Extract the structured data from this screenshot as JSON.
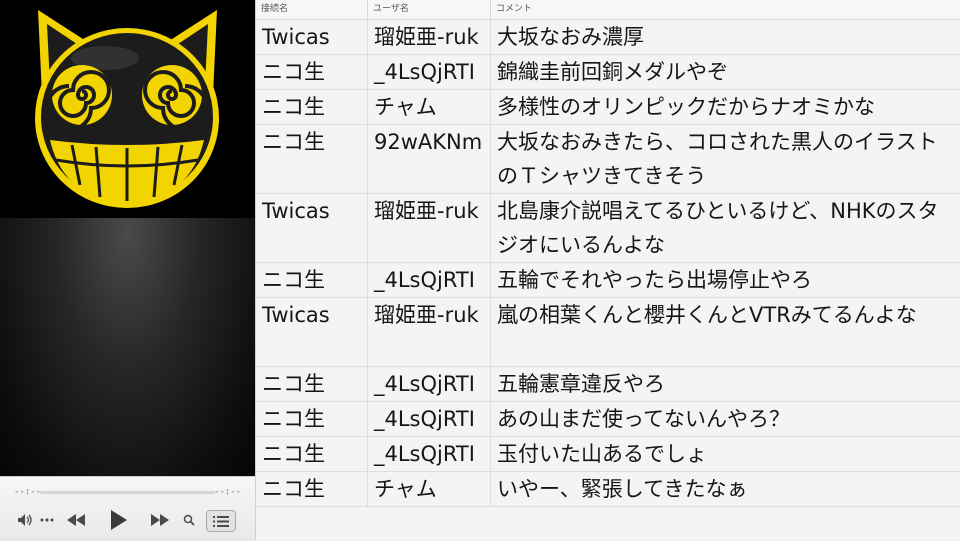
{
  "player": {
    "time_elapsed": "--:--",
    "time_remaining": "--:--",
    "controls": [
      "volume-icon",
      "more-icon",
      "rewind-icon",
      "play-icon",
      "fast-forward-icon",
      "search-icon",
      "playlist-icon"
    ]
  },
  "colors": {
    "mascot_yellow": "#f2d400",
    "mascot_body": "#1c1c1c",
    "table_bg": "#f4f4f4"
  },
  "table": {
    "headers": [
      "接続名",
      "ユーザ名",
      "コメント"
    ],
    "rows": [
      {
        "source": "Twicas",
        "user": "瑠姫亜-ruk",
        "comment": "大坂なおみ濃厚"
      },
      {
        "source": "ニコ生",
        "user": "_4LsQjRTI",
        "comment": "錦織圭前回銅メダルやぞ"
      },
      {
        "source": "ニコ生",
        "user": "チャム",
        "comment": "多様性のオリンピックだからナオミかな"
      },
      {
        "source": "ニコ生",
        "user": "92wAKNm",
        "comment": "大坂なおみきたら、コロされた黒人のイラストのＴシャツきてきそう"
      },
      {
        "source": "Twicas",
        "user": "瑠姫亜-ruk",
        "comment": "北島康介説唱えてるひといるけど、NHKのスタジオにいるんよな"
      },
      {
        "source": "ニコ生",
        "user": "_4LsQjRTI",
        "comment": "五輪でそれやったら出場停止やろ"
      },
      {
        "source": "Twicas",
        "user": "瑠姫亜-ruk",
        "comment": "嵐の相葉くんと櫻井くんとVTRみてるんよな"
      },
      {
        "source": "ニコ生",
        "user": "_4LsQjRTI",
        "comment": "五輪憲章違反やろ"
      },
      {
        "source": "ニコ生",
        "user": "_4LsQjRTI",
        "comment": "あの山まだ使ってないんやろ？"
      },
      {
        "source": "ニコ生",
        "user": "_4LsQjRTI",
        "comment": "玉付いた山あるでしょ"
      },
      {
        "source": "ニコ生",
        "user": "チャム",
        "comment": "いやー、緊張してきたなぁ"
      }
    ]
  }
}
